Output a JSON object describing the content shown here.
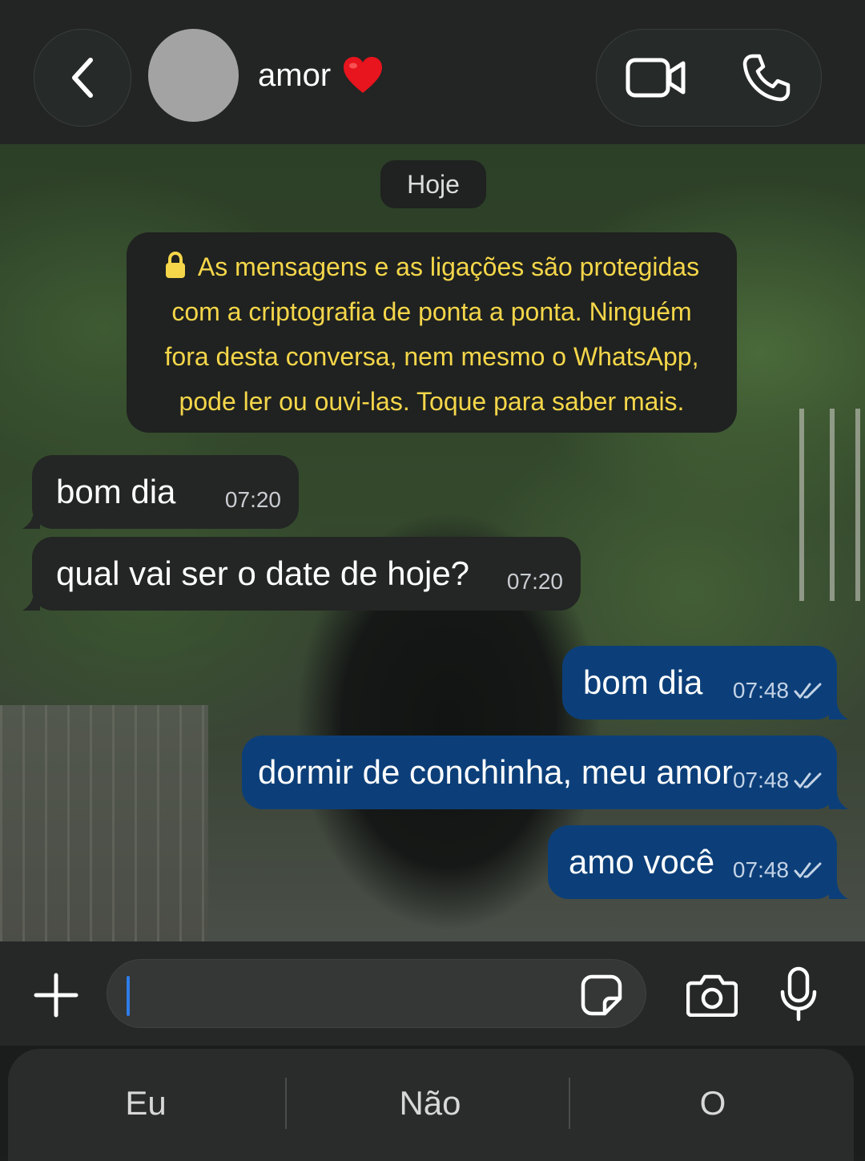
{
  "header": {
    "contact_name": "amor",
    "contact_emoji": "❤️",
    "icons": {
      "back": "chevron-left-icon",
      "video_call": "video-camera-icon",
      "voice_call": "phone-icon"
    }
  },
  "chat": {
    "date_label": "Hoje",
    "encryption_notice": {
      "lines": [
        "As mensagens e as ligações são protegidas",
        "com a criptografia de ponta a ponta. Ninguém",
        "fora desta conversa, nem mesmo o WhatsApp,",
        "pode ler ou ouvi-las. Toque para saber mais."
      ],
      "icon": "lock-icon",
      "color": "#f5d64a"
    },
    "messages": [
      {
        "direction": "incoming",
        "text": "bom dia",
        "time": "07:20"
      },
      {
        "direction": "incoming",
        "text": "qual vai ser o date de hoje?",
        "time": "07:20"
      },
      {
        "direction": "outgoing",
        "text": "bom dia",
        "time": "07:48",
        "status": "read"
      },
      {
        "direction": "outgoing",
        "text": "dormir de conchinha, meu amor",
        "time": "07:48",
        "status": "read"
      },
      {
        "direction": "outgoing",
        "text": "amo você",
        "time": "07:48",
        "status": "read"
      }
    ],
    "colors": {
      "incoming_bubble": "#232624",
      "outgoing_bubble": "#0c3f79"
    }
  },
  "compose": {
    "input_value": "",
    "icons": {
      "attach": "plus-icon",
      "sticker": "sticker-icon",
      "camera": "camera-icon",
      "microphone": "microphone-icon"
    }
  },
  "keyboard": {
    "suggestions": [
      "Eu",
      "Não",
      "O"
    ]
  }
}
